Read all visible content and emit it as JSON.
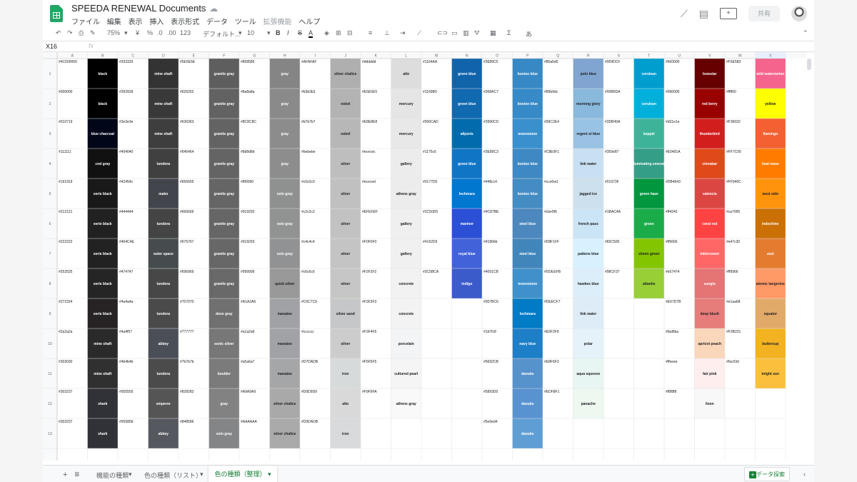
{
  "doc_title": "SPEEDA  RENEWAL Documents",
  "menu": [
    "ファイル",
    "編集",
    "表示",
    "挿入",
    "表示形式",
    "データ",
    "ツール",
    "拡張機能",
    "ヘルプ"
  ],
  "share_label": "共有",
  "toolbar": {
    "zoom": "75%",
    "currency": "¥",
    "percent": "%",
    "dec_less": ".0",
    "dec_more": ".00",
    "number_format": "123",
    "font": "デフォルト...",
    "font_size": "10",
    "bold": "B",
    "italic": "I",
    "strike": "S",
    "text_color": "A",
    "input_tool": "あ"
  },
  "formula_bar": {
    "cell_ref": "X16",
    "fx": "fx"
  },
  "columns": [
    "A",
    "B",
    "C",
    "D",
    "E",
    "F",
    "G",
    "H",
    "I",
    "J",
    "K",
    "L",
    "M",
    "N",
    "O",
    "P",
    "Q",
    "R",
    "S",
    "T",
    "U",
    "V",
    "W",
    "X"
  ],
  "rows": [
    [
      "#4C000000",
      "black",
      "#333333",
      "mine shaft",
      "#5E5E5E",
      "granite gray",
      "#858585",
      "gray",
      "#AFAFAF",
      "silver chalice",
      "#dddddd",
      "alto",
      "#1164AA",
      "green blue",
      "#3689C5",
      "boston blue",
      "#80a5d0",
      "polo blue",
      "#009DCF",
      "cerulean",
      "#660000",
      "lonestar",
      "#F5E583",
      "wild watermelon"
    ],
    [
      "#000000",
      "black",
      "#393939",
      "mine shaft",
      "#626262",
      "granite gray",
      "#8a8a8a",
      "gray",
      "#b3b3b3",
      "nobel",
      "#E5E5E5",
      "mercury",
      "#1169B0",
      "green blue",
      "#368AC7",
      "boston blue",
      "#89b9dc",
      "morning glory",
      "#00B0DA",
      "cerulean",
      "#990000",
      "red berry",
      "#ffff00",
      "yellow"
    ],
    [
      "#010719",
      "blue charcoal",
      "#3e3e3e",
      "mine shaft",
      "#636363",
      "granite gray",
      "#8C8C8C",
      "gray",
      "#b7b7b7",
      "nobel",
      "#E8E8E8",
      "mercury",
      "#006CAD",
      "allports",
      "#3990CD",
      "moonstone",
      "#99C2E4",
      "regent st blue",
      "#3DB49A",
      "keppel",
      "#d31e1e",
      "thunderbird",
      "#F36032",
      "flamingo"
    ],
    [
      "#111111",
      "cod gray",
      "#404040",
      "tundora",
      "#646464",
      "granite gray",
      "#8d8d8d",
      "gray",
      "#bebebe",
      "silver",
      "#ececec",
      "gallery",
      "#1175c6",
      "green blue",
      "#3E89C3",
      "boston blue",
      "#C8E0F1",
      "link water",
      "#359e87",
      "illuminating emerald",
      "#E0491A",
      "cinnabar",
      "#FF7C00",
      "heat wave"
    ],
    [
      "#191919",
      "eerie black",
      "#42454c",
      "mako",
      "#656565",
      "granite gray",
      "#8f9090",
      "oslo gray",
      "#c0c0c0",
      "silver",
      "#ececed",
      "athens gray",
      "#0177D0",
      "lochmara",
      "#448cc4",
      "boston blue",
      "#cce0ed",
      "jagged ice",
      "#01973F",
      "green haze",
      "#DB4643",
      "valencia",
      "#FF940C",
      "west side"
    ],
    [
      "#212121",
      "eerie black",
      "#444444",
      "tundora",
      "#666666",
      "granite gray",
      "#919292",
      "oslo gray",
      "#c2c2c2",
      "silver",
      "#EFEFEF",
      "gallery",
      "#2C50D5",
      "mariner",
      "#4C87BE",
      "steel blue",
      "#cbe5f6",
      "french pass",
      "#1BAC4A",
      "green",
      "#ff4242",
      "coral red",
      "#ca7005",
      "indochine"
    ],
    [
      "#222222",
      "eerie black",
      "#464C4E",
      "outer space",
      "#676767",
      "granite gray",
      "#919293",
      "oslo gray",
      "#c4c4c4",
      "silver",
      "#F0F0F0",
      "gallery",
      "#4162D9",
      "royal blue",
      "#4186bb",
      "steel blue",
      "#D8F1FF",
      "pattens blue",
      "#83C500",
      "sheen green",
      "#ff6666",
      "bittersweet",
      "#e47c30",
      "zest"
    ],
    [
      "#252525",
      "eerie black",
      "#474747",
      "tundora",
      "#696969",
      "granite gray",
      "#999999",
      "quick silver",
      "#c6c6c6",
      "silver",
      "#F2F2F2",
      "concrete",
      "#3C5BCA",
      "indigo",
      "#4091CB",
      "moonstone",
      "#DDEEFB",
      "hawkes blue",
      "#98CF37",
      "atlantis",
      "#e57474",
      "sunglo",
      "#ff9966",
      "atomic tangerine"
    ],
    [
      "#272324",
      "eerie black",
      "#4a4a4a",
      "tundora",
      "#707070",
      "dove gray",
      "#A1A2A6",
      "manatee",
      "#C6C7C9",
      "silver sand",
      "#F3F3F3",
      "concrete",
      "",
      "",
      "#007BC6",
      "lochmara",
      "#DEECF7",
      "link water",
      "",
      "",
      "#E67D7B",
      "deep blush",
      "#e1aa68",
      "equator"
    ],
    [
      "#2a2a2a",
      "mine shaft",
      "#4a4f57",
      "abbey",
      "#777777",
      "sonic silver",
      "#a1a2a6",
      "manatee",
      "#cccccc",
      "silver",
      "#F3F4F5",
      "porcelain",
      "",
      "",
      "#1d7fc8",
      "navy blue",
      "#E5F2F9",
      "polar",
      "",
      "",
      "#fad6ba",
      "apricot peach",
      "#F2B221",
      "buttercup"
    ],
    [
      "#303030",
      "mine shaft",
      "#4b4b4b",
      "tundora",
      "#7b7b7b",
      "boulder",
      "#a5a6a7",
      "manatee",
      "#D7DADB",
      "iron",
      "#F5F5F5",
      "cultured pearl",
      "",
      "",
      "#5692CB",
      "danube",
      "#E8F6F3",
      "aqua squeeze",
      "",
      "",
      "#ffeeee",
      "fair pink",
      "#fac03d",
      "bright sun"
    ],
    [
      "#303237",
      "shark",
      "#555555",
      "emperor",
      "#828282",
      "gray",
      "#A9A9A9",
      "silver chalice",
      "#D9D9D9",
      "alto",
      "#F9F9FA",
      "athens gray",
      "",
      "",
      "#5893D0",
      "danube",
      "#EDF8F1",
      "panache",
      "",
      "",
      "#f8f8f8",
      "linen",
      "",
      ""
    ],
    [
      "#303237",
      "shark",
      "#55585E",
      "abbey",
      "#848586",
      "oslo gray",
      "#AAAAAA",
      "silver chalice",
      "#D9DADB",
      "iron",
      "",
      "",
      "",
      "",
      "#5e9ed4",
      "danube",
      "",
      "",
      "",
      "",
      "",
      "",
      "",
      ""
    ]
  ],
  "sheet_tabs": [
    "機能の種類",
    "色の種類（リスト）",
    "色の種類（整理）"
  ],
  "explore_label": "データ探索",
  "colors": {
    "accent_green": "#188038",
    "header_bg": "#f8f9fa",
    "grid_line": "#e2e2e2",
    "selected_header": "#e8f0fe",
    "B": [
      "#000000",
      "#000000",
      "#010719",
      "#111111",
      "#191919",
      "#212121",
      "#222222",
      "#252525",
      "#272324",
      "#2a2a2a",
      "#303030",
      "#303237",
      "#303237"
    ],
    "D": [
      "#333333",
      "#393939",
      "#3e3e3e",
      "#404040",
      "#42454c",
      "#444444",
      "#464c4e",
      "#474747",
      "#4a4a4a",
      "#4a4f57",
      "#4b4b4b",
      "#555555",
      "#55585e"
    ],
    "F": [
      "#5e5e5e",
      "#626262",
      "#636363",
      "#646464",
      "#656565",
      "#666666",
      "#676767",
      "#696969",
      "#707070",
      "#777777",
      "#7b7b7b",
      "#828282",
      "#848586"
    ],
    "H": [
      "#858585",
      "#8a8a8a",
      "#8c8c8c",
      "#8d8d8d",
      "#8f9090",
      "#919292",
      "#919293",
      "#999999",
      "#a1a2a6",
      "#a1a2a6",
      "#a5a6a7",
      "#a9a9a9",
      "#aaaaaa"
    ],
    "J": [
      "#afafaf",
      "#b3b3b3",
      "#b7b7b7",
      "#bebebe",
      "#c0c0c0",
      "#c2c2c2",
      "#c4c4c4",
      "#c6c6c6",
      "#c6c7c9",
      "#cccccc",
      "#d7dadb",
      "#d9d9d9",
      "#d9dadb"
    ],
    "L": [
      "#dddddd",
      "#e5e5e5",
      "#e8e8e8",
      "#ececec",
      "#ececed",
      "#efefef",
      "#f0f0f0",
      "#f2f2f2",
      "#f3f3f3",
      "#f3f4f5",
      "#f5f5f5",
      "#f9f9fa",
      "#ffffff"
    ],
    "N": [
      "#1164aa",
      "#1169b0",
      "#006cad",
      "#1175c6",
      "#0177d0",
      "#2c50d5",
      "#4162d9",
      "#3c5bca",
      "#ffffff",
      "#ffffff",
      "#ffffff",
      "#ffffff",
      "#ffffff"
    ],
    "P": [
      "#3689c5",
      "#368ac7",
      "#3990cd",
      "#3e89c3",
      "#448cc4",
      "#4c87be",
      "#4186bb",
      "#4091cb",
      "#007bc6",
      "#1d7fc8",
      "#5692cb",
      "#5893d0",
      "#5e9ed4"
    ],
    "R": [
      "#80a5d0",
      "#89b9dc",
      "#99c2e4",
      "#c8e0f1",
      "#cce0ed",
      "#cbe5f6",
      "#d8f1ff",
      "#ddeefb",
      "#deecf7",
      "#e5f2f9",
      "#e8f6f3",
      "#edf8f1",
      "#ffffff"
    ],
    "T": [
      "#009dcf",
      "#00b0da",
      "#3db49a",
      "#359e87",
      "#01973f",
      "#1bac4a",
      "#83c500",
      "#98cf37",
      "#ffffff",
      "#ffffff",
      "#ffffff",
      "#ffffff",
      "#ffffff"
    ],
    "V": [
      "#660000",
      "#990000",
      "#d31e1e",
      "#e0491a",
      "#db4643",
      "#ff4242",
      "#ff6666",
      "#e57474",
      "#e67d7b",
      "#fad6ba",
      "#ffeeee",
      "#f8f8f8",
      "#ffffff"
    ],
    "X": [
      "#f5648c",
      "#ffff00",
      "#f36032",
      "#ff7c00",
      "#ff940c",
      "#ca7005",
      "#e47c30",
      "#ff9966",
      "#e1aa68",
      "#f2b221",
      "#fac03d",
      "#ffffff",
      "#ffffff"
    ]
  }
}
